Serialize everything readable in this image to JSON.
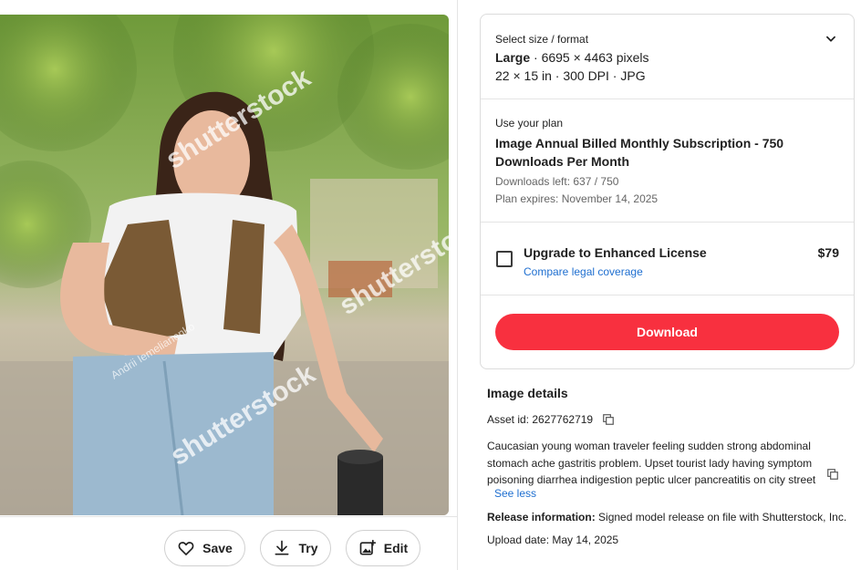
{
  "preview": {
    "watermark_brand": "shutterstock",
    "watermark_author": "Andrii Iemelianenko",
    "actions": {
      "save_label": "Save",
      "try_label": "Try",
      "edit_label": "Edit"
    }
  },
  "purchase": {
    "size": {
      "label": "Select size / format",
      "name": "Large",
      "dimensions": " · 6695 × 4463 pixels",
      "details": "22 × 15 in · 300 DPI · JPG"
    },
    "plan": {
      "label": "Use your plan",
      "title": "Image Annual Billed Monthly Subscription - 750 Downloads Per Month",
      "downloads_left": "Downloads left: 637 / 750",
      "expires": "Plan expires: November 14, 2025"
    },
    "upgrade": {
      "title": "Upgrade to Enhanced License",
      "link": "Compare legal coverage",
      "price": "$79",
      "checked": false
    },
    "download_label": "Download"
  },
  "details": {
    "heading": "Image details",
    "asset_id": "Asset id: 2627762719",
    "description": "Caucasian young woman traveler feeling sudden strong abdominal stomach ache gastritis problem. Upset tourist lady having symptom poisoning diarrhea indigestion peptic ulcer pancreatitis on city street",
    "see_less": "See less",
    "release_label": "Release information:",
    "release_text": " Signed model release on file with Shutterstock, Inc.",
    "upload_date": "Upload date: May 14, 2025"
  },
  "colors": {
    "accent": "#f8303f",
    "link": "#1f6fd0"
  }
}
